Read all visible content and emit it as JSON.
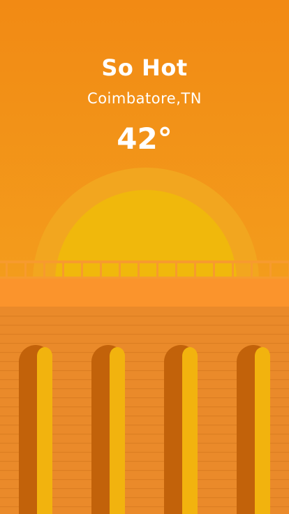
{
  "weather": {
    "condition": "So Hot",
    "location": "Coimbatore,TN",
    "temperature": "42°"
  },
  "colors": {
    "sky_top": "#F28C16",
    "sky_bottom": "#F39A1A",
    "sun_halo": "#F2A720",
    "sun": "#F0B80C",
    "railing": "#F79B2E",
    "deck": "#FB942C",
    "wall": "#EA8A2A",
    "wall_lines": "#DC7E22",
    "arch_shadow": "#C2620A",
    "arch_light": "#F2B30E"
  },
  "icons": [
    "sun-icon"
  ]
}
